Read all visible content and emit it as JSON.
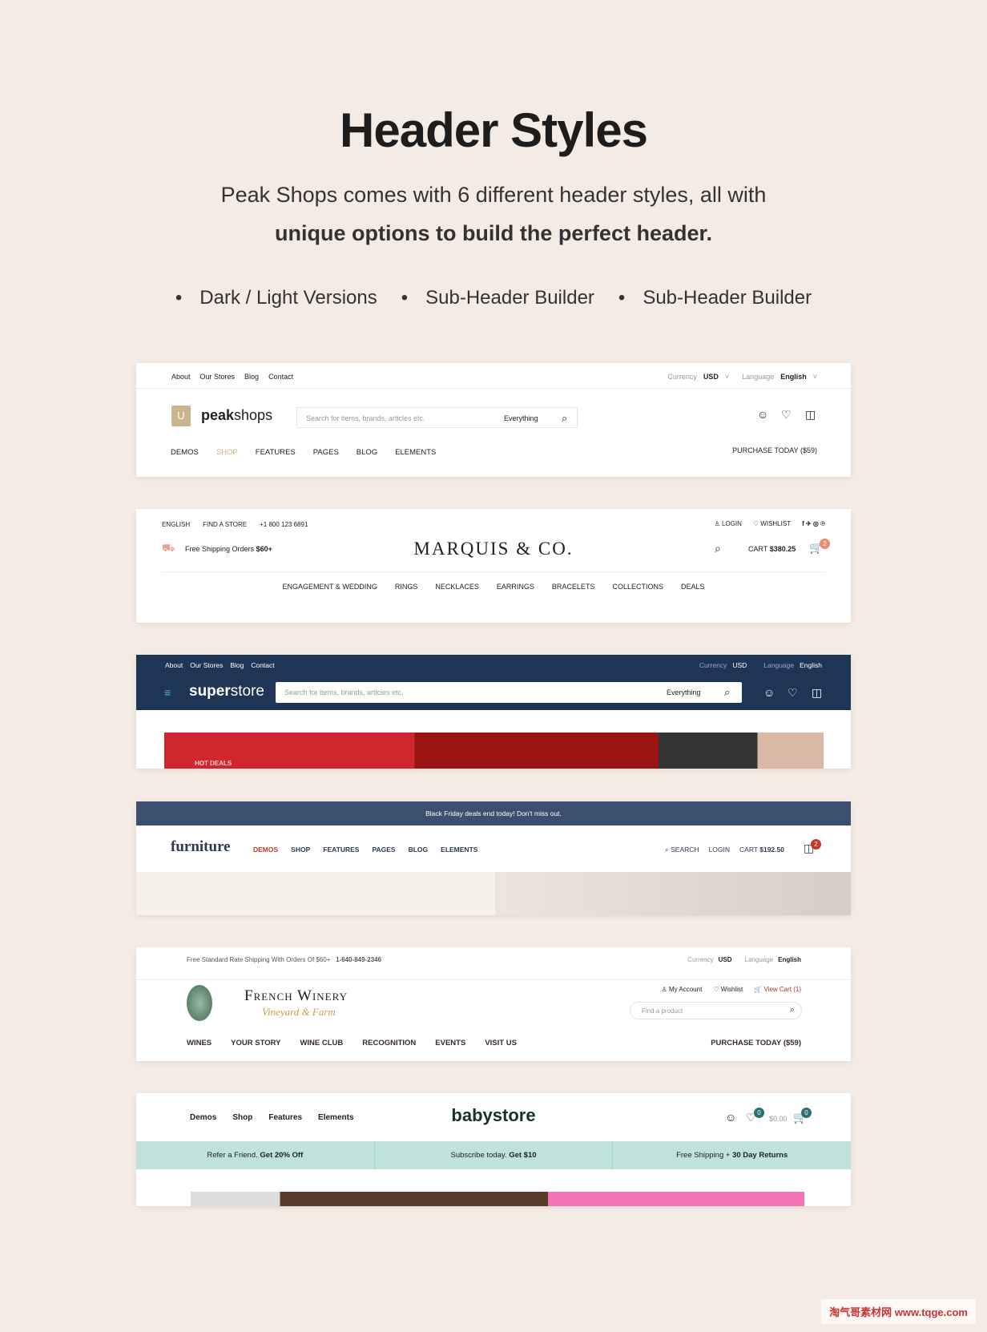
{
  "heading": {
    "title": "Header Styles",
    "line1": "Peak Shops comes with 6 different header styles, all with",
    "line2": "unique options to build the perfect header."
  },
  "bullets": [
    "Dark / Light Versions",
    "Sub-Header Builder",
    "Sub-Header Builder"
  ],
  "h1": {
    "top_links": [
      "About",
      "Our Stores",
      "Blog",
      "Contact"
    ],
    "currency_label": "Currency",
    "currency": "USD",
    "language_label": "Language",
    "language": "English",
    "logo_bold": "peak",
    "logo_rest": "shops",
    "search_placeholder": "Search for items, brands, articles etc.",
    "category": "Everything",
    "nav": [
      "DEMOS",
      "SHOP",
      "FEATURES",
      "PAGES",
      "BLOG",
      "ELEMENTS"
    ],
    "purchase": "PURCHASE TODAY ($59)",
    "accent": "#c8b48e"
  },
  "h2": {
    "language": "ENGLISH",
    "find_store": "FIND A STORE",
    "phone": "+1 800 123 6891",
    "login": "LOGIN",
    "wishlist": "WISHLIST",
    "shipping": "Free Shipping Orders",
    "shipping_amount": "$60+",
    "logo": "MARQUIS & CO.",
    "cart_label": "CART",
    "cart_total": "$380.25",
    "cart_count": "2",
    "nav": [
      "ENGAGEMENT & WEDDING",
      "RINGS",
      "NECKLACES",
      "EARRINGS",
      "BRACELETS",
      "COLLECTIONS",
      "DEALS"
    ]
  },
  "h3": {
    "top_links": [
      "About",
      "Our Stores",
      "Blog",
      "Contact"
    ],
    "currency_label": "Currency",
    "currency": "USD",
    "language_label": "Language",
    "language": "English",
    "logo": "superstore",
    "search_placeholder": "Search for items, brands, articles etc.",
    "category": "Everything",
    "banner": "HOT DEALS",
    "bg": "#1f3556"
  },
  "h4": {
    "announcement": "Black Friday deals end today! Don't miss out.",
    "logo": "furniture",
    "nav": [
      "DEMOS",
      "SHOP",
      "FEATURES",
      "PAGES",
      "BLOG",
      "ELEMENTS"
    ],
    "search": "SEARCH",
    "login": "LOGIN",
    "cart_label": "CART",
    "cart_total": "$192.50",
    "cart_count": "2",
    "bar": "#3c4f6e"
  },
  "h5": {
    "shipping": "Free Standard Rate Shipping With Orders Of $60+",
    "phone": "1-640-849-2346",
    "currency_label": "Currency",
    "currency": "USD",
    "language_label": "Language",
    "language": "English",
    "logo": "French Winery",
    "tagline": "Vineyard & Farm",
    "account": "My Account",
    "wishlist": "Wishlist",
    "cart": "View Cart (1)",
    "search_placeholder": "Find a product",
    "nav": [
      "WINES",
      "YOUR STORY",
      "WINE CLUB",
      "RECOGNITION",
      "EVENTS",
      "VISIT US"
    ],
    "purchase": "PURCHASE TODAY ($59)"
  },
  "h6": {
    "nav": [
      "Demos",
      "Shop",
      "Features",
      "Elements"
    ],
    "logo": "babystore",
    "wish_count": "0",
    "cart_total": "$0.00",
    "cart_count": "0",
    "promos": [
      {
        "text": "Refer a Friend.",
        "bold": "Get 20% Off"
      },
      {
        "text": "Subscribe today.",
        "bold": "Get $10"
      },
      {
        "text": "Free Shipping +",
        "bold": "30 Day Returns"
      }
    ],
    "bar": "#bfe3dc"
  },
  "watermark": "淘气哥素材网 www.tqge.com"
}
